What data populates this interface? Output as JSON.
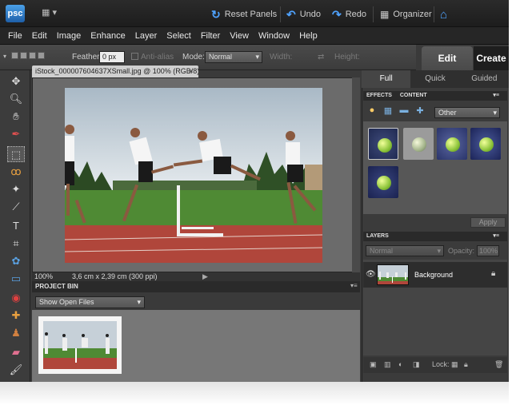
{
  "app": {
    "logo_text": "psc",
    "layout_icon": "layout-icon",
    "reset_panels_label": "Reset Panels",
    "undo_label": "Undo",
    "redo_label": "Redo",
    "organizer_label": "Organizer",
    "accent": "#4fa3ff"
  },
  "menu": {
    "items": [
      "File",
      "Edit",
      "Image",
      "Enhance",
      "Layer",
      "Select",
      "Filter",
      "View",
      "Window",
      "Help"
    ]
  },
  "options": {
    "feather_label": "Feather:",
    "feather_value": "0 px",
    "antialias_label": "Anti-alias",
    "mode_label": "Mode:",
    "mode_value": "Normal",
    "width_label": "Width:",
    "height_label": "Height:"
  },
  "mode_tabs": {
    "edit": "Edit",
    "create": "Create"
  },
  "document": {
    "tab_title": "iStock_000007604637XSmall.jpg @ 100% (RGB/8)",
    "close": "×"
  },
  "status": {
    "zoom": "100%",
    "doc_size": "3,6 cm x 2,39 cm (300 ppi)"
  },
  "project_bin": {
    "title": "PROJECT BIN",
    "filter_value": "Show Open Files"
  },
  "panel_tabs": [
    "Full",
    "Quick",
    "Guided"
  ],
  "effects": {
    "tab1": "EFFECTS",
    "tab2": "CONTENT",
    "category_value": "Other",
    "apply_label": "Apply"
  },
  "layers": {
    "title": "LAYERS",
    "blend_value": "Normal",
    "opacity_label": "Opacity:",
    "opacity_value": "100%",
    "layer_name": "Background",
    "lock_label": "Lock:"
  }
}
